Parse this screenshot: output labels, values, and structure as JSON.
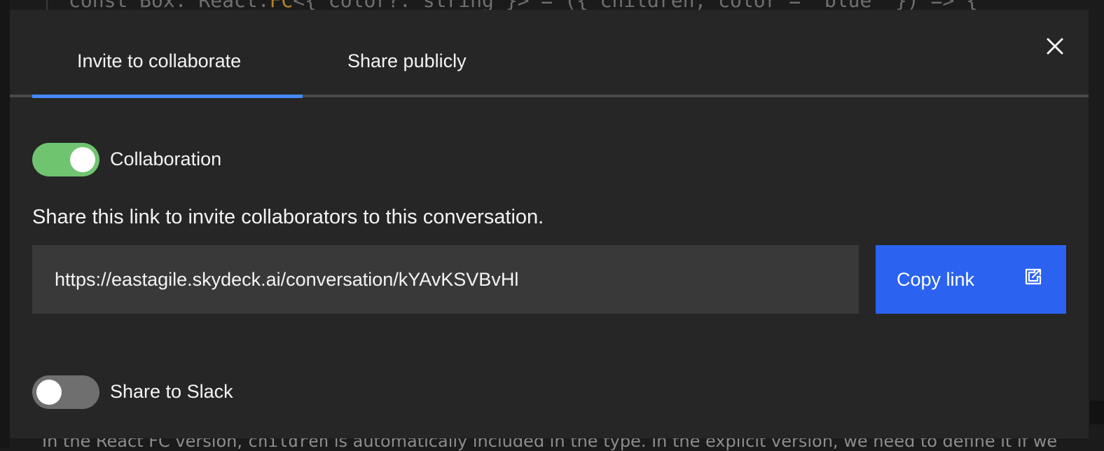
{
  "background": {
    "code_fragment_a": "const Box: React.",
    "code_fragment_fc": "FC",
    "code_fragment_b": "<{ color?: string }> = ({ children, color = 'blue' }) => {",
    "prose_a": "In the React FC version, ",
    "prose_code": "children",
    "prose_b": " is automatically included in the type. In the explicit version, we need to define it if we"
  },
  "modal": {
    "tabs": [
      {
        "label": "Invite to collaborate",
        "active": true
      },
      {
        "label": "Share publicly",
        "active": false
      }
    ],
    "close_icon": "close-icon"
  },
  "collaboration": {
    "label": "Collaboration",
    "enabled": true
  },
  "share": {
    "description": "Share this link to invite collaborators to this conversation.",
    "link": "https://eastagile.skydeck.ai/conversation/kYAvKSVBvHl",
    "copy_label": "Copy link",
    "copy_icon": "share-link-icon"
  },
  "slack": {
    "label": "Share to Slack",
    "enabled": false
  },
  "colors": {
    "accent": "#4589ff",
    "primary_button": "#2b63f0",
    "toggle_on": "#6fc46f",
    "toggle_off": "#6f6f6f",
    "modal_bg": "#262626",
    "field_bg": "#393939"
  }
}
